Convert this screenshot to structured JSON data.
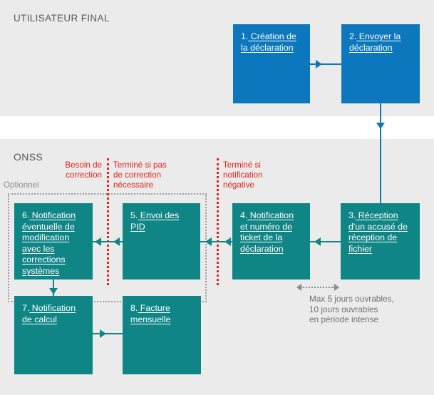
{
  "lanes": {
    "user": {
      "title": "UTILISATEUR FINAL"
    },
    "onss": {
      "title": "ONSS"
    }
  },
  "colors": {
    "band": "#ebebeb",
    "blue": "#0c77bd",
    "teal": "#108585",
    "red": "#e2231a",
    "gray_text": "#6e7072"
  },
  "nodes": [
    {
      "id": "n1",
      "num": "1.",
      "text": " Création de la déclaration",
      "color": "blue",
      "lane": "user"
    },
    {
      "id": "n2",
      "num": "2.",
      "text": " Envoyer la déclaration",
      "color": "blue",
      "lane": "user"
    },
    {
      "id": "n3",
      "num": "3.",
      "text": " Réception d'un accusé de réception de fichier",
      "color": "teal",
      "lane": "onss"
    },
    {
      "id": "n4",
      "num": "4.",
      "text": " Notification et numéro de ticket de la déclaration",
      "color": "teal",
      "lane": "onss"
    },
    {
      "id": "n5",
      "num": "5.",
      "text": " Envoi des PID",
      "color": "teal",
      "lane": "onss"
    },
    {
      "id": "n6",
      "num": "6.",
      "text": " Notification éventuelle de modification avec les corrections systèmes",
      "color": "teal",
      "lane": "onss"
    },
    {
      "id": "n7",
      "num": "7.",
      "text": " Notification de calcul",
      "color": "teal",
      "lane": "onss"
    },
    {
      "id": "n8",
      "num": "8.",
      "text": " Facture mensuelle",
      "color": "teal",
      "lane": "onss"
    }
  ],
  "decisions": [
    {
      "id": "d1",
      "label": "Besoin de\ncorrection"
    },
    {
      "id": "d2",
      "label": "Terminé si pas\nde correction\nnécessaire"
    },
    {
      "id": "d3",
      "label": "Terminé si\nnotification\nnégative"
    }
  ],
  "optional": {
    "label": "Optionnel"
  },
  "sla": {
    "note": "Max 5 jours ouvrables,\n10 jours ouvrables\nen période intense"
  }
}
